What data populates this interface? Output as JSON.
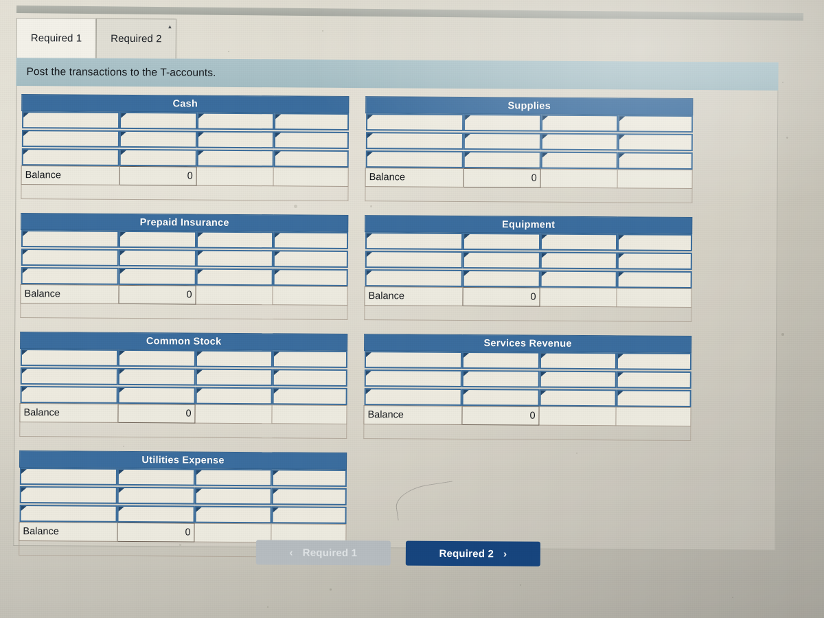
{
  "tabs": [
    {
      "label": "Required 1",
      "active": true
    },
    {
      "label": "Required 2",
      "active": false
    }
  ],
  "banner": {
    "instruction": "Post the transactions to the T-accounts."
  },
  "labels": {
    "balance": "Balance",
    "balance_value": "0",
    "blank": ""
  },
  "accounts": {
    "left": [
      {
        "title": "Cash",
        "rows": 3,
        "balance_label": "Balance",
        "balance_value": "0"
      },
      {
        "title": "Prepaid Insurance",
        "rows": 3,
        "balance_label": "Balance",
        "balance_value": "0"
      },
      {
        "title": "Common Stock",
        "rows": 3,
        "balance_label": "Balance",
        "balance_value": "0"
      },
      {
        "title": "Utilities Expense",
        "rows": 3,
        "balance_label": "Balance",
        "balance_value": "0"
      }
    ],
    "right": [
      {
        "title": "Supplies",
        "rows": 3,
        "balance_label": "Balance",
        "balance_value": "0"
      },
      {
        "title": "Equipment",
        "rows": 3,
        "balance_label": "Balance",
        "balance_value": "0"
      },
      {
        "title": "Services Revenue",
        "rows": 3,
        "balance_label": "Balance",
        "balance_value": "0"
      }
    ]
  },
  "footer": {
    "prev": {
      "label": "Required 1",
      "chevron": "‹",
      "disabled": true
    },
    "next": {
      "label": "Required 2",
      "chevron": "›",
      "disabled": false
    }
  },
  "colors": {
    "account_header": "#3b6d9e",
    "banner": "#a9c3c9",
    "input_border": "#3c6d9b",
    "next_button": "#17457e",
    "prev_button": "#b6bcc0",
    "page_background": "#ddd9cc"
  },
  "icons": {
    "tab_caret": "▴"
  }
}
